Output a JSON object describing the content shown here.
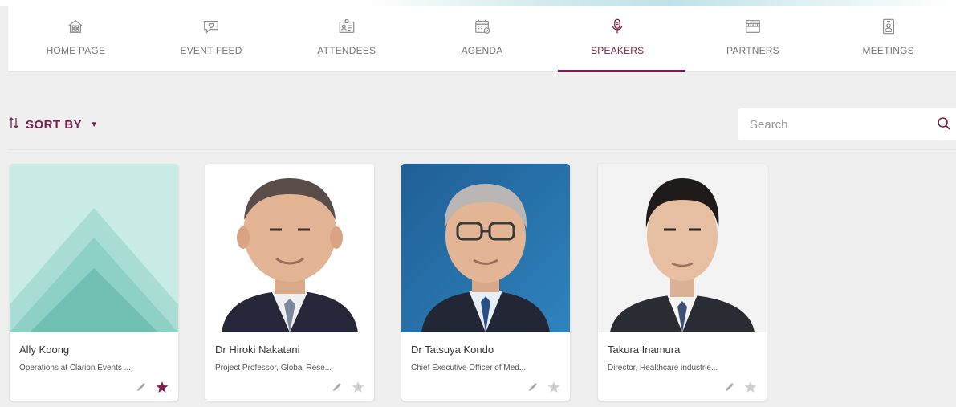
{
  "nav": {
    "items": [
      {
        "label": "HOME PAGE",
        "icon": "home-icon"
      },
      {
        "label": "EVENT FEED",
        "icon": "chat-heart-icon"
      },
      {
        "label": "ATTENDEES",
        "icon": "id-card-icon"
      },
      {
        "label": "AGENDA",
        "icon": "calendar-icon"
      },
      {
        "label": "SPEAKERS",
        "icon": "microphone-icon"
      },
      {
        "label": "PARTNERS",
        "icon": "storefront-icon"
      },
      {
        "label": "MEETINGS",
        "icon": "badge-icon"
      }
    ],
    "active": "SPEAKERS"
  },
  "toolbar": {
    "sort_label": "SORT BY"
  },
  "search": {
    "placeholder": "Search"
  },
  "colors": {
    "accent": "#7a1f4f",
    "placeholder_teal": "#bfe5df"
  },
  "speakers": [
    {
      "name": "Ally Koong",
      "role": "Operations at Clarion Events ...",
      "favorite": true
    },
    {
      "name": "Dr Hiroki Nakatani",
      "role": "Project Professor, Global Rese...",
      "favorite": false
    },
    {
      "name": "Dr Tatsuya Kondo",
      "role": "Chief Executive Officer of Med...",
      "favorite": false
    },
    {
      "name": "Takura Inamura",
      "role": "Director, Healthcare industrie...",
      "favorite": false
    }
  ]
}
